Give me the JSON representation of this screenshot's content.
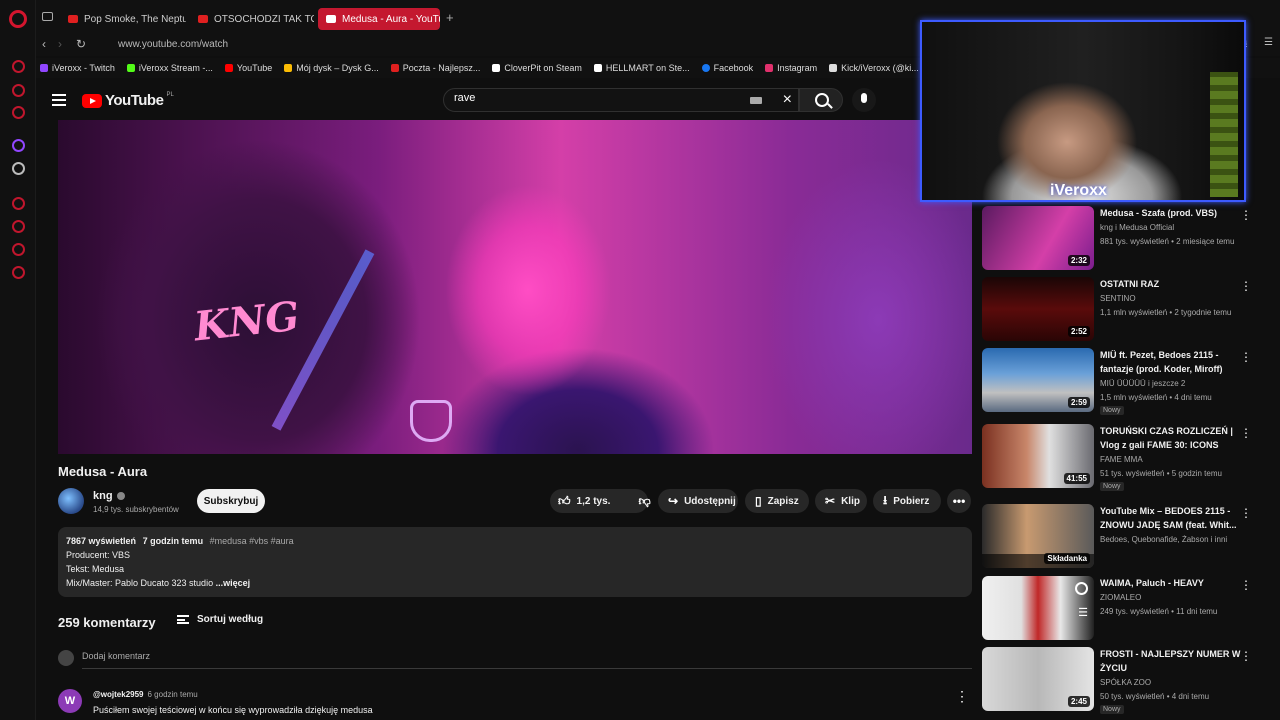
{
  "browser": {
    "tabs": [
      {
        "label": "Pop Smoke, The Neptunes"
      },
      {
        "label": "OTSOCHODZI TAK TO LE"
      },
      {
        "label": "Medusa - Aura - YouTu"
      }
    ],
    "new_tab": "+",
    "url": "www.youtube.com/watch",
    "bookmarks": [
      {
        "label": "iVeroxx - Twitch",
        "color": "#9146ff"
      },
      {
        "label": "iVeroxx Stream -...",
        "color": "#53fc18"
      },
      {
        "label": "YouTube",
        "color": "#ff0000"
      },
      {
        "label": "Mój dysk – Dysk G...",
        "color": "#fbbc04"
      },
      {
        "label": "Poczta - Najlepsz...",
        "color": "#e0201f"
      },
      {
        "label": "CloverPit on Steam",
        "color": "#ffffff"
      },
      {
        "label": "HELLMART on Ste...",
        "color": "#ffffff"
      },
      {
        "label": "Facebook",
        "color": "#1877f2"
      },
      {
        "label": "Instagram",
        "color": "#e1306c"
      },
      {
        "label": "Kick/iVeroxx (@ki...",
        "color": "#dddddd"
      }
    ]
  },
  "youtube": {
    "logo_text": "YouTube",
    "region": "PL",
    "search_value": "rave"
  },
  "video": {
    "title": "Medusa - Aura",
    "channel": "kng",
    "subscribers": "14,9 tys. subskrybentów",
    "subscribe_label": "Subskrybuj",
    "likes": "1,2 tys.",
    "share_label": "Udostępnij",
    "save_label": "Zapisz",
    "clip_label": "Klip",
    "download_label": "Pobierz",
    "overlay_logo": "KNG"
  },
  "description": {
    "views": "7867 wyświetleń",
    "age": "7 godzin temu",
    "tags": "#medusa #vbs #aura",
    "line1": "Producent: VBS",
    "line2": "Tekst: Medusa",
    "line3": "Mix/Master: Pablo Ducato 323 studio",
    "more": "...więcej"
  },
  "comments": {
    "count": "259 komentarzy",
    "sort_label": "Sortuj według",
    "add_placeholder": "Dodaj komentarz",
    "items": [
      {
        "avatar": "W",
        "author": "@wojtek2959",
        "time": "6 godzin temu",
        "text": "Puściłem swojej teściowej w końcu się wyprowadziła dziękuję medusa"
      }
    ]
  },
  "webcam": {
    "name": "iVeroxx"
  },
  "recommendations": [
    {
      "title": "Medusa - Szafa (prod. VBS)",
      "channel": "kng i Medusa Official",
      "meta": "881 tys. wyświetleń • 2 miesiące temu",
      "duration": "2:32",
      "badge": ""
    },
    {
      "title": "OSTATNI RAZ",
      "channel": "SENTINO",
      "meta": "1,1 mln wyświetleń • 2 tygodnie temu",
      "duration": "2:52",
      "badge": ""
    },
    {
      "title": "MIÜ ft. Pezet, Bedoes 2115 - fantazje (prod. Koder, Miroff)",
      "channel": "MIÜ ÜÜÜÜÜ i jeszcze 2",
      "meta": "1,5 mln wyświetleń • 4 dni temu",
      "duration": "2:59",
      "badge": "Nowy"
    },
    {
      "title": "TORUŃSKI CZAS ROZLICZEŃ | Vlog z gali FAME 30: ICONS",
      "channel": "FAME MMA",
      "meta": "51 tys. wyświetleń • 5 godzin temu",
      "duration": "41:55",
      "badge": "Nowy"
    },
    {
      "title": "YouTube Mix – BEDOES 2115 - ZNOWU JADĘ SAM (feat. Whit...",
      "channel": "Bedoes, Quebonafide, Żabson i inni",
      "meta": "",
      "duration": "Składanka",
      "badge": ""
    },
    {
      "title": "WAIMA, Paluch - HEAVY",
      "channel": "ZIOMALEO",
      "meta": "249 tys. wyświetleń • 11 dni temu",
      "duration": "",
      "badge": ""
    },
    {
      "title": "FROSTI - NAJLEPSZY NUMER W ŻYCIU",
      "channel": "SPÓŁKA ZOO",
      "meta": "50 tys. wyświetleń • 4 dni temu",
      "duration": "2:45",
      "badge": "Nowy"
    }
  ]
}
